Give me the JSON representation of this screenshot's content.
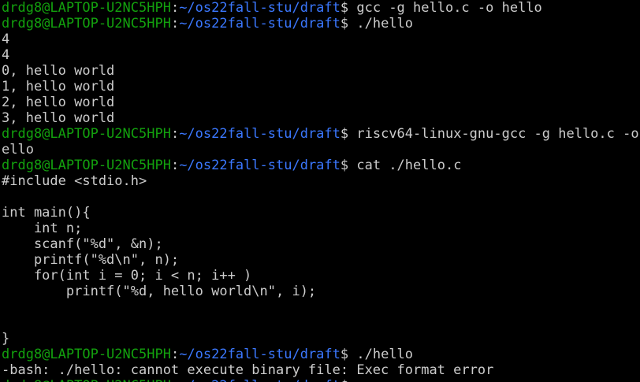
{
  "colors": {
    "background": "#000000",
    "text": "#cccccc",
    "prompt_user": "#13a10e",
    "prompt_path": "#3b78ff"
  },
  "prompt": {
    "user_host": "drdg8@LAPTOP-U2NC5HPH",
    "separator": ":",
    "path": "~/os22fall-stu/draft",
    "symbol": "$"
  },
  "lines": [
    {
      "type": "prompt",
      "command": " gcc -g hello.c -o hello"
    },
    {
      "type": "prompt",
      "command": " ./hello"
    },
    {
      "type": "output",
      "text": "4"
    },
    {
      "type": "output",
      "text": "4"
    },
    {
      "type": "output",
      "text": "0, hello world"
    },
    {
      "type": "output",
      "text": "1, hello world"
    },
    {
      "type": "output",
      "text": "2, hello world"
    },
    {
      "type": "output",
      "text": "3, hello world"
    },
    {
      "type": "prompt",
      "command": " riscv64-linux-gnu-gcc -g hello.c -o h"
    },
    {
      "type": "output",
      "text": "ello"
    },
    {
      "type": "prompt",
      "command": " cat ./hello.c"
    },
    {
      "type": "output",
      "text": "#include <stdio.h>"
    },
    {
      "type": "output",
      "text": ""
    },
    {
      "type": "output",
      "text": "int main(){"
    },
    {
      "type": "output",
      "text": "    int n;"
    },
    {
      "type": "output",
      "text": "    scanf(\"%d\", &n);"
    },
    {
      "type": "output",
      "text": "    printf(\"%d\\n\", n);"
    },
    {
      "type": "output",
      "text": "    for(int i = 0; i < n; i++ )"
    },
    {
      "type": "output",
      "text": "        printf(\"%d, hello world\\n\", i);"
    },
    {
      "type": "output",
      "text": ""
    },
    {
      "type": "output",
      "text": ""
    },
    {
      "type": "output",
      "text": "}"
    },
    {
      "type": "prompt",
      "command": " ./hello"
    },
    {
      "type": "output",
      "text": "-bash: ./hello: cannot execute binary file: Exec format error"
    },
    {
      "type": "prompt",
      "command": " "
    }
  ]
}
